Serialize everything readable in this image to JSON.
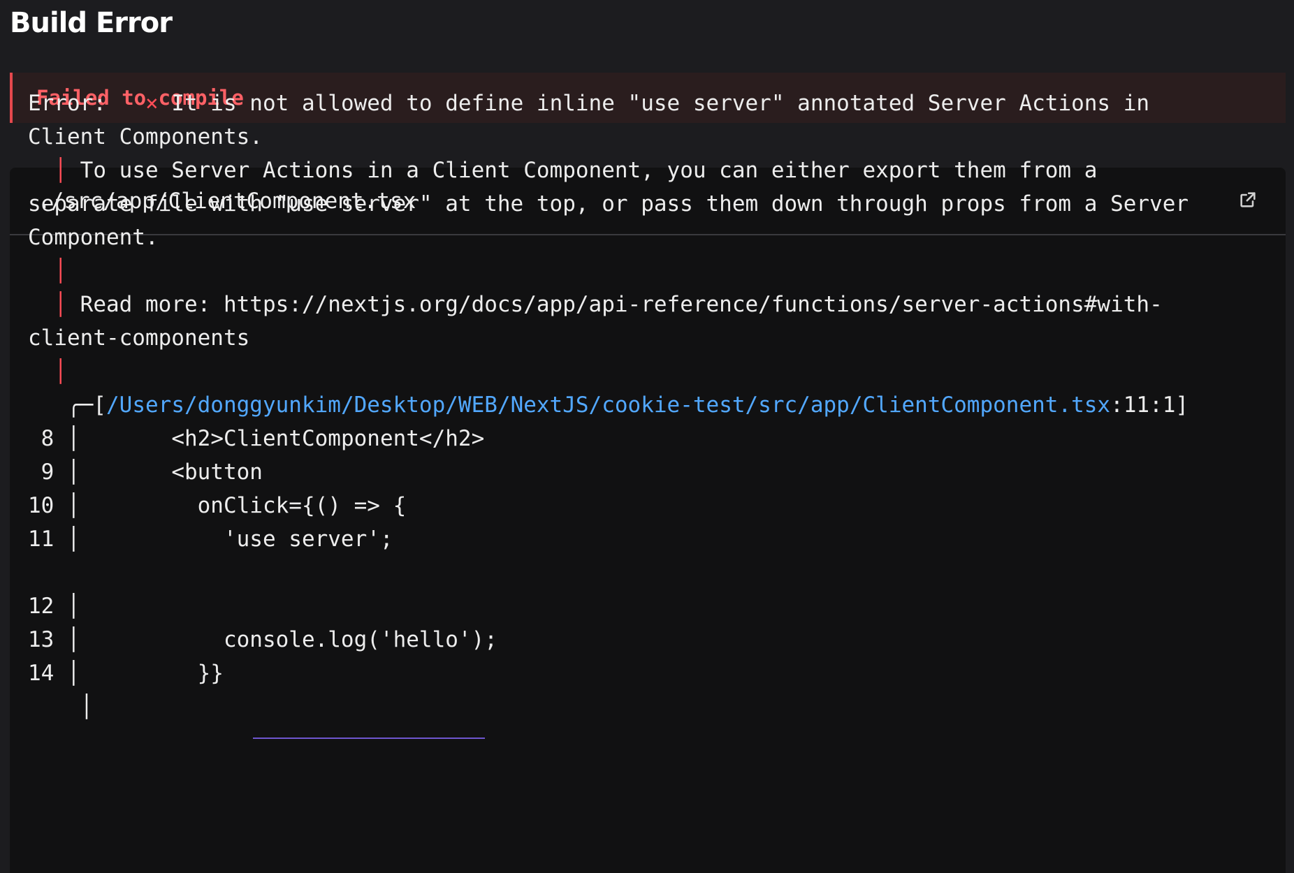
{
  "header": {
    "title": "Build Error"
  },
  "banner": {
    "message": "Failed to compile"
  },
  "file": {
    "path": "./src/app/ClientComponent.tsx",
    "open_icon": "external-link-icon"
  },
  "error": {
    "prefix": "Error:",
    "cross": "×",
    "line1": " It is not allowed to define inline \"use server\" annotated Server Actions in",
    "line2": "Client Components.",
    "pipe": "│",
    "line3": " To use Server Actions in a Client Component, you can either export them from a",
    "line4": "separate file with \"use server\" at the top, or pass them down through props from a Server",
    "line5": "Component.",
    "line6": " Read more: https://nextjs.org/docs/app/api-reference/functions/server-actions#with-",
    "line7": "client-components",
    "location_prefix": "╭─[",
    "location_path": "/Users/donggyunkim/Desktop/WEB/NextJS/cookie-test/src/app/ClientComponent.tsx",
    "location_suffix": ":11:1]",
    "code": [
      {
        "num": "8",
        "text": "      <h2>ClientComponent</h2>"
      },
      {
        "num": "9",
        "text": "      <button"
      },
      {
        "num": "10",
        "text": "        onClick={() => {"
      },
      {
        "num": "11",
        "text": "          'use server';"
      },
      {
        "num": "12",
        "text": ""
      },
      {
        "num": "13",
        "text": "          console.log('hello');"
      },
      {
        "num": "14",
        "text": "        }}"
      }
    ],
    "dot": "·"
  }
}
